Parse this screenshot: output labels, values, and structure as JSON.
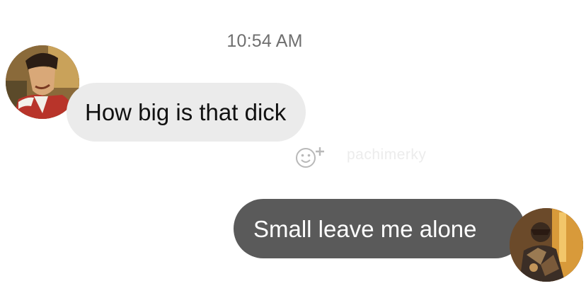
{
  "conversation": {
    "timestamp": "10:54 AM",
    "messages": [
      {
        "direction": "incoming",
        "text": "How big is that dick"
      },
      {
        "direction": "outgoing",
        "text": "Small leave me alone"
      }
    ],
    "reaction_icon": "add-reaction-icon",
    "watermark": "pachimerky"
  },
  "colors": {
    "incoming_bubble": "#ebebeb",
    "outgoing_bubble": "#5a5a5a",
    "timestamp_text": "#6f6f6f"
  }
}
